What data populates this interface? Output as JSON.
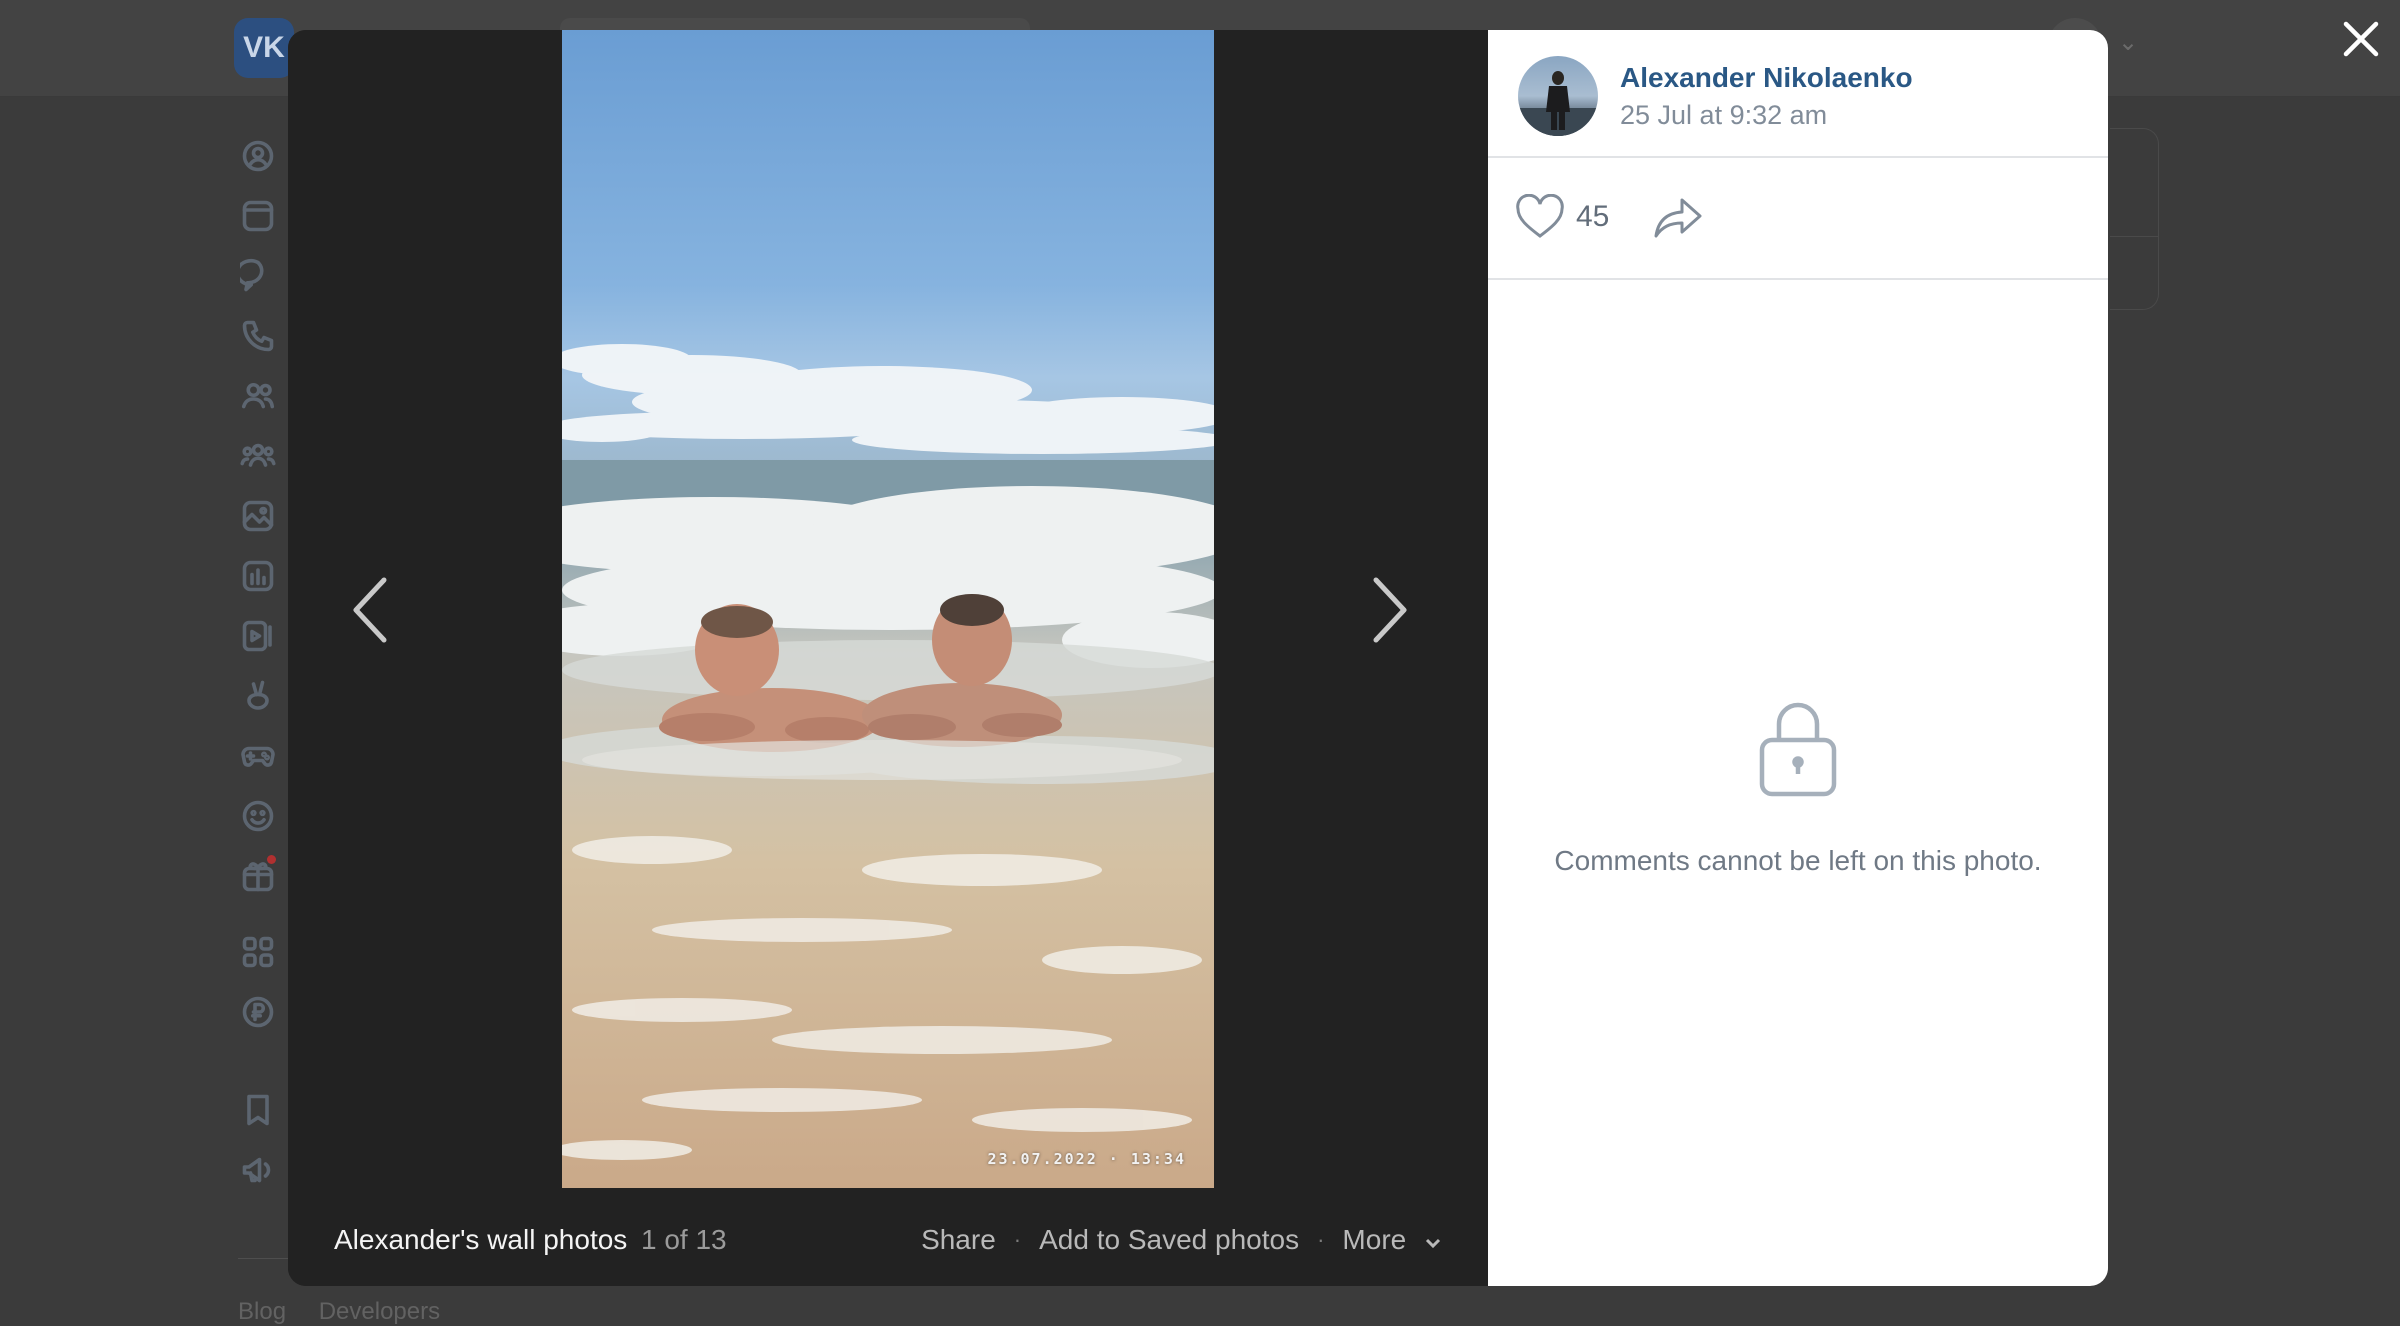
{
  "background": {
    "logo": "VK",
    "footer_links": [
      "Blog",
      "Developers"
    ],
    "nav_icons": [
      "profile-icon",
      "news-icon",
      "messenger-icon",
      "calls-icon",
      "friends-icon",
      "communities-icon",
      "photos-icon",
      "music-icon",
      "videos-icon",
      "clips-icon",
      "games-icon",
      "stickers-icon",
      "gifts-icon",
      "apps-icon",
      "payments-icon",
      "bookmarks-icon",
      "ads-icon"
    ]
  },
  "viewer": {
    "photo": {
      "timestamp": "23.07.2022 · 13:34",
      "description_colors": {
        "sky": "#7fb0df",
        "sea": "#9fb6bf",
        "sand": "#cfae8c"
      }
    },
    "album_title": "Alexander's wall photos",
    "counter": "1 of 13",
    "actions": {
      "share": "Share",
      "save": "Add to Saved photos",
      "more": "More",
      "separator": "·"
    },
    "author": {
      "name": "Alexander Nikolaenko",
      "date": "25 Jul at 9:32 am"
    },
    "likes": "45",
    "comments_locked_text": "Comments cannot be left on this photo."
  },
  "colors": {
    "link": "#2a5885",
    "secondary_text": "#818c99",
    "overlay": "#3b3b3b"
  }
}
